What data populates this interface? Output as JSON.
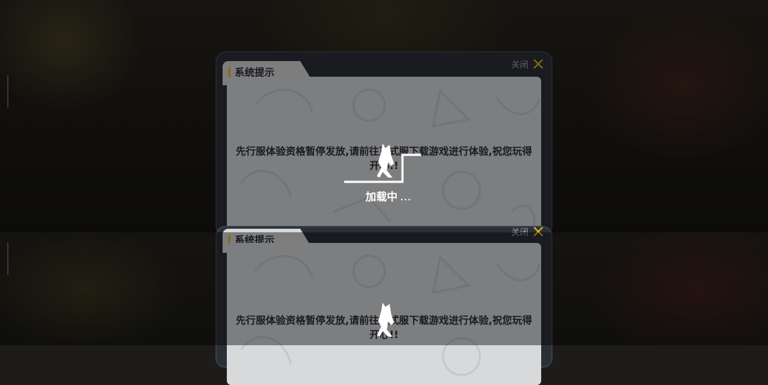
{
  "top_instance": {
    "dialog": {
      "title": "系统提示",
      "close_label": "关闭",
      "message": "先行服体验资格暂停发放,请前往正式服下载游戏进行体验,祝您玩得开心!!"
    },
    "loader": {
      "label": "加载中",
      "dots": "..."
    }
  },
  "bottom_instance": {
    "dialog": {
      "title": "系统提示",
      "close_label": "关闭",
      "message": "先行服体验资格暂停发放,请前往正式服下载游戏进行体验,祝您玩得开心!!"
    }
  },
  "colors": {
    "accent": "#e8b41c",
    "dialog_frame": "#2b3038",
    "content_bg": "#d8d9db"
  },
  "icons": {
    "close": "close-icon",
    "runner": "running-character-icon"
  }
}
